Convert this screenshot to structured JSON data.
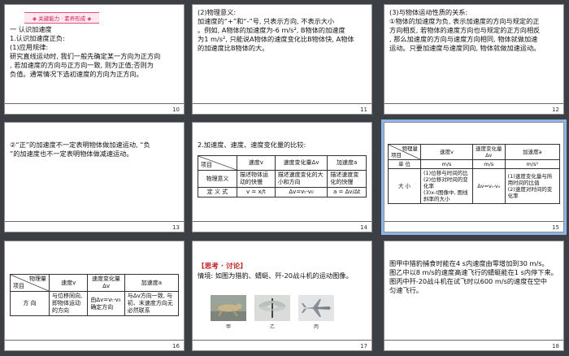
{
  "slides": [
    {
      "number": "10",
      "banner": "关键能力 · 素养形成",
      "text": "一  认识加速度\n1.认识加速度正负:\n(1)应用规律:\n研究直线运动时, 我们一般先确定某一方向为正方向\n, 若加速度的方向与正方向一致, 则为正值;否则为\n负值。通常情况下选初速度的方向为正方向。"
    },
    {
      "number": "11",
      "text": "(2)物理意义:\n加速度的“+”和“-”号, 只表示方向, 不表示大小\n。例如, A物体的加速度为-6 m/s², B物体的加速度\n为1 m/s², 只能说A物体的速度变化比B物体快, A物体\n的加速度比B物体的大。"
    },
    {
      "number": "12",
      "text": "(3)与物体运动性质的关系:\n①物体的加速度为负, 表示加速度的方向与规定的正\n方向相反, 若物体的速度方向也与规定的正方向相反\n, 那么加速度的方向与速度方向相同, 物体就做加速\n运动。只要加速度与速度同向, 物体就做加速运动。"
    },
    {
      "number": "13",
      "text": "②“正”的加速度不一定表明物体做加速运动, “负\n”的加速度也不一定表明物体做减速运动。"
    },
    {
      "number": "14",
      "text": "2.加速度、速度、速度变化量的比较:",
      "table": {
        "corner_top": "",
        "corner_bottom": "项目",
        "headers": [
          "速度v",
          "速度变化量Δv",
          "加速度a"
        ],
        "rows": [
          {
            "label": "物理意义",
            "cells": [
              "描述物体运动的快慢",
              "描述速度变化的大小和方向",
              "描述速度变化的快慢"
            ]
          },
          {
            "label": "定 义 式",
            "cells": [
              "v = x/t",
              "Δv=vₜ-v₀",
              "a = Δv/Δt"
            ]
          }
        ]
      }
    },
    {
      "number": "15",
      "table": {
        "corner_top": "物理量",
        "corner_bottom": "项目",
        "headers": [
          "速度v",
          "速度变化量Δv",
          "加速度a"
        ],
        "units_label": "单  位",
        "units": [
          "m/s",
          "m/s",
          "m/s²"
        ],
        "rows": [
          {
            "label": "大  小",
            "cells": [
              "(1)位移与时间的比\n(2)位移对时间的变化率\n(3)x-t图像中, 图线斜率的大小",
              "Δv=vₜ-v₀",
              "(1)速度变化量与所用时间的比值\n(2)速度对时间的变化率"
            ]
          }
        ]
      }
    },
    {
      "number": "16",
      "table": {
        "corner_top": "物理量",
        "corner_bottom": "项目",
        "headers": [
          "速度v",
          "速度变化量Δv",
          "加速度a"
        ],
        "rows": [
          {
            "label": "方  向",
            "cells": [
              "与位移同向, 即物体运动的方向",
              "由Δv=vₜ-v₀确定方向",
              "与Δv方向一致, 与初、末速度方向无必然联系"
            ]
          }
        ]
      }
    },
    {
      "number": "17",
      "heading": "【思考 · 讨论】",
      "text": "情境: 如图为猎豹、蜻蜓、歼-20战斗机的运动图像。",
      "image_labels": [
        "甲",
        "乙",
        "丙"
      ]
    },
    {
      "number": "18",
      "text": "图甲中猎豹捕食时能在4 s内速度由零增加到30 m/s。\n图乙中以8 m/s的速度高速飞行的蜻蜓能在1 s内停下来。\n图丙中歼-20战斗机在试飞时以600 m/s的速度在空中\n匀速飞行。"
    }
  ]
}
